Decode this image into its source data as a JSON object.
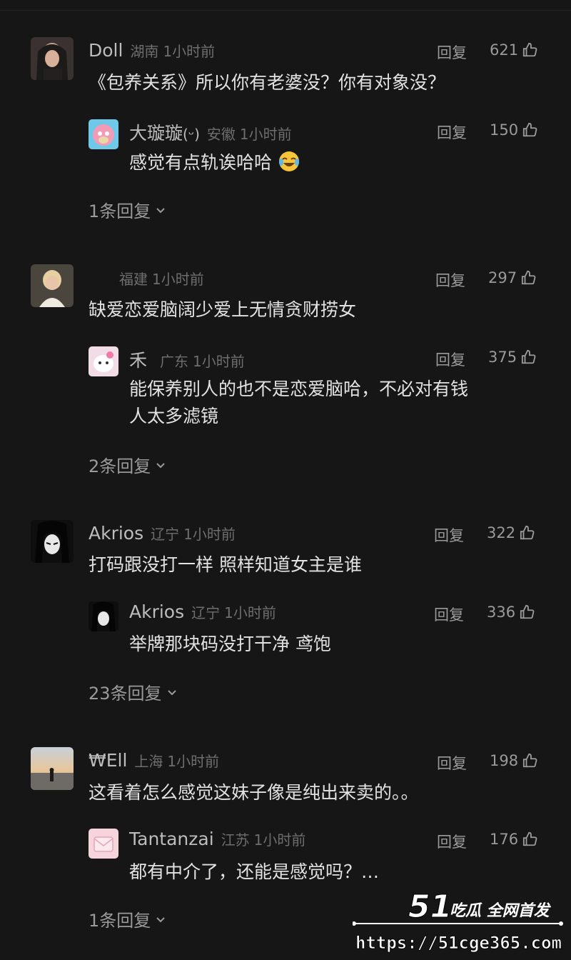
{
  "ui": {
    "reply_label": "回复"
  },
  "comments": [
    {
      "user": "Doll",
      "location": "湖南",
      "time": "1小时前",
      "likes": "621",
      "text": "《包养关系》所以你有老婆没？你有对象没？",
      "reply": {
        "user": "大璇璇",
        "location": "安徽",
        "time": "1小时前",
        "likes": "150",
        "text": "感觉有点轨诶哈哈"
      },
      "more_replies": "1条回复"
    },
    {
      "user": "",
      "location": "福建",
      "time": "1小时前",
      "likes": "297",
      "text": "缺爱恋爱脑阔少爱上无情贪财捞女",
      "reply": {
        "user": "禾",
        "location": "广东",
        "time": "1小时前",
        "likes": "375",
        "text": "能保养别人的也不是恋爱脑哈，不必对有钱",
        "text2": "人太多滤镜"
      },
      "more_replies": "2条回复"
    },
    {
      "user": "Akrios",
      "location": "辽宁",
      "time": "1小时前",
      "likes": "322",
      "text": "打码跟没打一样 照样知道女主是谁",
      "reply": {
        "user": "Akrios",
        "location": "辽宁",
        "time": "1小时前",
        "likes": "336",
        "text": "举牌那块码没打干净 鸢饱"
      },
      "more_replies": "23条回复"
    },
    {
      "user": "₩Ell",
      "location": "上海",
      "time": "1小时前",
      "likes": "198",
      "text": "这看着怎么感觉这妹子像是纯出来卖的。。",
      "reply": {
        "user": "Tantanzai",
        "location": "江苏",
        "time": "1小时前",
        "likes": "176",
        "text": "都有中介了，还能是感觉吗？…"
      },
      "more_replies": "1条回复"
    }
  ],
  "watermark": {
    "brand": "51",
    "slogan": "吃瓜 全网首发",
    "url": "https://51cge365.com"
  },
  "icons": {
    "like": "thumbs-up-icon",
    "expand": "chevron-down-icon",
    "emoji": "laughing-tears-emoji-icon"
  }
}
